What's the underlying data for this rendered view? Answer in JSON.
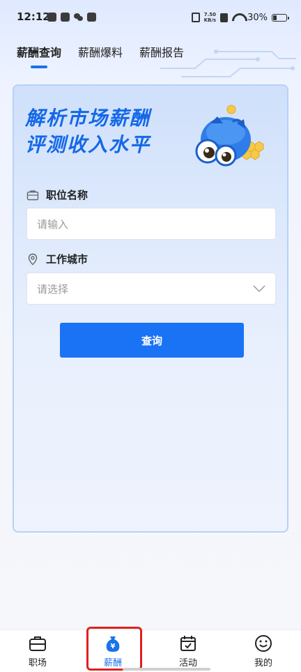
{
  "status_bar": {
    "time": "12:12",
    "net_speed_value": "7.50",
    "net_speed_unit": "KB/s",
    "battery_percent": "30%",
    "battery_level": 0.3
  },
  "top_tabs": [
    {
      "label": "薪酬查询",
      "active": true
    },
    {
      "label": "薪酬爆料",
      "active": false
    },
    {
      "label": "薪酬报告",
      "active": false
    }
  ],
  "card": {
    "headline_line1": "解析市场薪酬",
    "headline_line2": "评测收入水平",
    "position_label": "职位名称",
    "position_placeholder": "请输入",
    "city_label": "工作城市",
    "city_placeholder": "请选择",
    "query_button": "查询"
  },
  "bottom_nav": [
    {
      "label": "职场",
      "icon": "briefcase-icon",
      "active": false
    },
    {
      "label": "薪酬",
      "icon": "money-bag-icon",
      "active": true
    },
    {
      "label": "活动",
      "icon": "calendar-check-icon",
      "active": false
    },
    {
      "label": "我的",
      "icon": "smiley-icon",
      "active": false
    }
  ],
  "colors": {
    "accent": "#1a73f5",
    "headline": "#1468e8",
    "highlight": "#e02020"
  }
}
